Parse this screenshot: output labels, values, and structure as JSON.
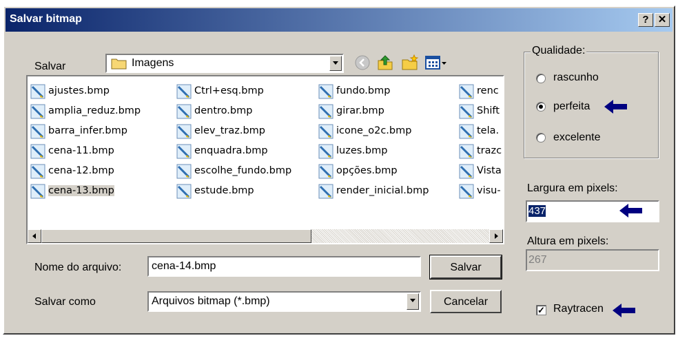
{
  "window": {
    "title": "Salvar bitmap",
    "help_label": "?",
    "close_label": "✕"
  },
  "location": {
    "label": "Salvar",
    "folder": "Imagens"
  },
  "toolbar": {
    "icons": [
      "back-icon",
      "up-folder-icon",
      "new-folder-icon",
      "view-menu-icon"
    ]
  },
  "files": [
    [
      "ajustes.bmp",
      "amplia_reduz.bmp",
      "barra_infer.bmp",
      "cena-11.bmp",
      "cena-12.bmp",
      "cena-13.bmp"
    ],
    [
      "Ctrl+esq.bmp",
      "dentro.bmp",
      "elev_traz.bmp",
      "enquadra.bmp",
      "escolhe_fundo.bmp",
      "estude.bmp"
    ],
    [
      "fundo.bmp",
      "girar.bmp",
      "icone_o2c.bmp",
      "luzes.bmp",
      "opções.bmp",
      "render_inicial.bmp"
    ],
    [
      "renc",
      "Shift",
      "tela.",
      "trazc",
      "Vista",
      "visu-"
    ]
  ],
  "selected_file": "cena-13.bmp",
  "filename": {
    "label": "Nome do arquivo:",
    "value": "cena-14.bmp"
  },
  "filetype": {
    "label": "Salvar como",
    "value": "Arquivos bitmap (*.bmp)"
  },
  "buttons": {
    "save": "Salvar",
    "cancel": "Cancelar"
  },
  "quality": {
    "label": "Qualidade:",
    "options": [
      "rascunho",
      "perfeita",
      "excelente"
    ],
    "selected": "perfeita"
  },
  "width": {
    "label": "Largura em pixels:",
    "value": "437"
  },
  "height": {
    "label": "Altura em pixels:",
    "value": "267"
  },
  "raytrace": {
    "label": "Raytracen",
    "checked": true
  },
  "colors": {
    "title_start": "#0a246a",
    "title_end": "#a6caf0",
    "face": "#d4d0c8",
    "selection": "#0a246a",
    "arrow": "#000080"
  }
}
